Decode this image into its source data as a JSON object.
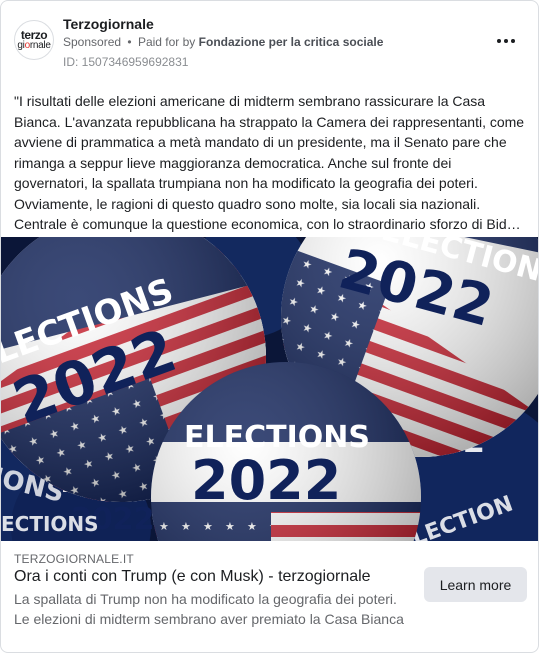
{
  "advertiser": {
    "avatar_line1": "terzo",
    "avatar_line2_a": "gi",
    "avatar_line2_b": "o",
    "avatar_line2_c": "rnale",
    "name": "Terzogiornale",
    "sponsored_label": "Sponsored",
    "separator": "•",
    "paid_prefix": "Paid for by",
    "paid_by": "Fondazione per la critica sociale",
    "ad_id": "ID: 1507346959692831"
  },
  "body_lines": [
    "\"I risultati delle elezioni americane di midterm sembrano rassicurare la Casa",
    "Bianca. L'avanzata repubblicana ha strappato la Camera dei rappresentanti, come",
    "avviene di prammatica a metà mandato di un presidente, ma il Senato pare che",
    "rimanga a seppur lieve maggioranza democratica. Anche sul fronte dei",
    "governatori, la spallata trumpiana non ha modificato la geografia dei poteri.",
    "Ovviamente, le ragioni di questo quadro sono molte, sia locali sia nazionali.",
    "Centrale è comunque la questione economica, con lo straordinario sforzo di Bide…"
  ],
  "media": {
    "word": "ELECTIONS",
    "year": "2022",
    "colors": {
      "navy": "#10225a",
      "red": "#c8202f",
      "white": "#ffffff",
      "dark": "#0b1638"
    }
  },
  "link": {
    "domain": "TERZOGIORNALE.IT",
    "headline": "Ora i conti con Trump (e con Musk) - terzogiornale",
    "description": "La spallata di Trump non ha modificato la geografia dei poteri. Le elezioni di midterm sembrano aver premiato la Casa Bianca",
    "cta_label": "Learn more"
  },
  "icons": [
    "more-options-icon"
  ]
}
